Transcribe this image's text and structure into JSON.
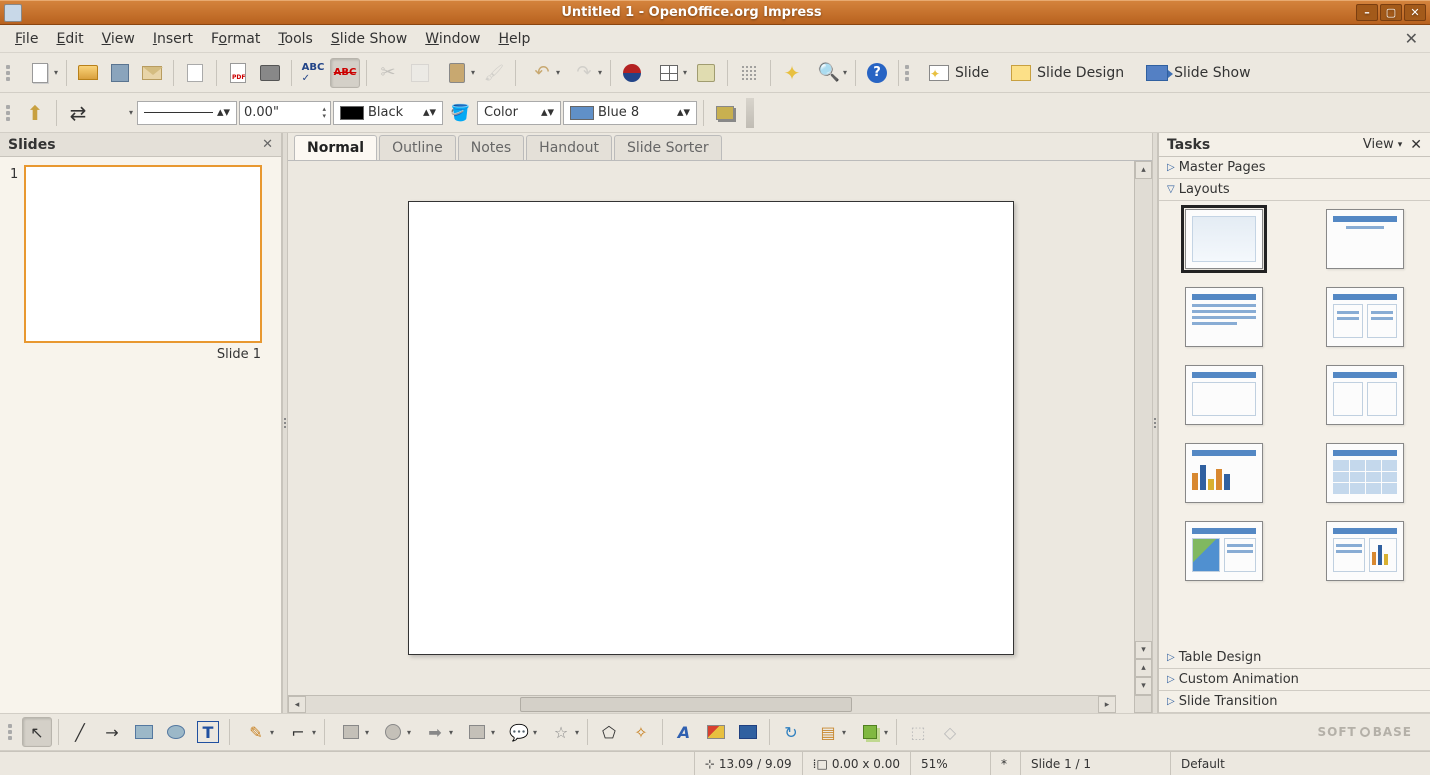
{
  "titlebar": {
    "text": "Untitled 1 - OpenOffice.org Impress"
  },
  "menubar": {
    "items": [
      {
        "u": "F",
        "rest": "ile"
      },
      {
        "u": "E",
        "rest": "dit"
      },
      {
        "u": "V",
        "rest": "iew"
      },
      {
        "u": "I",
        "rest": "nsert"
      },
      {
        "u": "F",
        "rest": "ormat",
        "pre": "F",
        "label": "Format",
        "underline": 1
      },
      {
        "u": "T",
        "rest": "ools"
      },
      {
        "u": "S",
        "rest": "lide Show",
        "label": "Slide Show"
      },
      {
        "u": "W",
        "rest": "indow"
      },
      {
        "u": "H",
        "rest": "elp"
      }
    ],
    "file": "File",
    "edit": "Edit",
    "view": "View",
    "insert": "Insert",
    "format": "Format",
    "tools": "Tools",
    "slideshow": "Slide Show",
    "window": "Window",
    "help": "Help"
  },
  "toolbar1": {
    "slide": "Slide",
    "slide_design": "Slide Design",
    "slide_show": "Slide Show"
  },
  "toolbar2": {
    "line_width": "0.00\"",
    "line_color_label": "Black",
    "fill_type": "Color",
    "fill_color": "Blue 8"
  },
  "slides_panel": {
    "title": "Slides",
    "slide_num": "1",
    "slide_label": "Slide 1"
  },
  "view_tabs": {
    "normal": "Normal",
    "outline": "Outline",
    "notes": "Notes",
    "handout": "Handout",
    "sorter": "Slide Sorter"
  },
  "tasks": {
    "title": "Tasks",
    "view": "View",
    "master_pages": "Master Pages",
    "layouts": "Layouts",
    "table_design": "Table Design",
    "custom_animation": "Custom Animation",
    "slide_transition": "Slide Transition"
  },
  "statusbar": {
    "pos": "13.09 / 9.09",
    "size": "0.00 x 0.00",
    "zoom": "51%",
    "modified": "*",
    "slide_count": "Slide 1 / 1",
    "template": "Default"
  },
  "watermark": {
    "left": "SOFT",
    "right": "BASE"
  }
}
